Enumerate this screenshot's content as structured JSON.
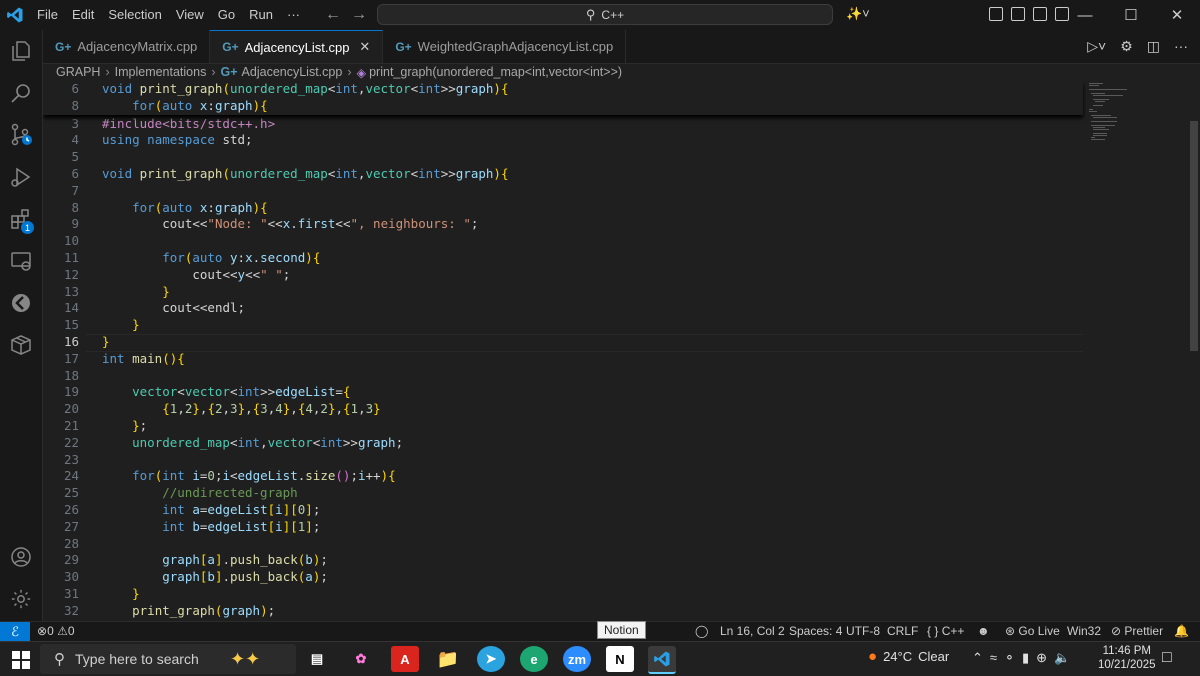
{
  "menu": [
    "File",
    "Edit",
    "Selection",
    "View",
    "Go",
    "Run",
    "···"
  ],
  "search": {
    "text": "C++"
  },
  "tabs": [
    {
      "label": "AdjacencyMatrix.cpp"
    },
    {
      "label": "AdjacencyList.cpp",
      "active": true
    },
    {
      "label": "WeightedGraphAdjacencyList.cpp"
    }
  ],
  "breadcrumb": {
    "folder": "GRAPH",
    "sub": "Implementations",
    "file": "AdjacencyList.cpp",
    "symbol": "print_graph(unordered_map<int,vector<int>>)"
  },
  "editor": {
    "sticky_lines": [
      {
        "n": "6",
        "text": "void print_graph(unordered_map<int,vector<int>>graph){"
      },
      {
        "n": "8",
        "text": "    for(auto x:graph){"
      }
    ],
    "lines": [
      {
        "n": "3",
        "text": "#include<bits/stdc++.h>"
      },
      {
        "n": "4",
        "text": "using namespace std;"
      },
      {
        "n": "5",
        "text": ""
      },
      {
        "n": "6",
        "text": "void print_graph(unordered_map<int,vector<int>>graph){"
      },
      {
        "n": "7",
        "text": ""
      },
      {
        "n": "8",
        "text": "    for(auto x:graph){"
      },
      {
        "n": "9",
        "text": "        cout<<\"Node: \"<<x.first<<\", neighbours: \";"
      },
      {
        "n": "10",
        "text": ""
      },
      {
        "n": "11",
        "text": "        for(auto y:x.second){"
      },
      {
        "n": "12",
        "text": "            cout<<y<<\" \";"
      },
      {
        "n": "13",
        "text": "        }"
      },
      {
        "n": "14",
        "text": "        cout<<endl;"
      },
      {
        "n": "15",
        "text": "    }"
      },
      {
        "n": "16",
        "text": "}"
      },
      {
        "n": "17",
        "text": "int main(){"
      },
      {
        "n": "18",
        "text": ""
      },
      {
        "n": "19",
        "text": "    vector<vector<int>>edgeList={"
      },
      {
        "n": "20",
        "text": "        {1,2},{2,3},{3,4},{4,2},{1,3}"
      },
      {
        "n": "21",
        "text": "    };"
      },
      {
        "n": "22",
        "text": "    unordered_map<int,vector<int>>graph;"
      },
      {
        "n": "23",
        "text": ""
      },
      {
        "n": "24",
        "text": "    for(int i=0;i<edgeList.size();i++){"
      },
      {
        "n": "25",
        "text": "        //undirected-graph"
      },
      {
        "n": "26",
        "text": "        int a=edgeList[i][0];"
      },
      {
        "n": "27",
        "text": "        int b=edgeList[i][1];"
      },
      {
        "n": "28",
        "text": ""
      },
      {
        "n": "29",
        "text": "        graph[a].push_back(b);"
      },
      {
        "n": "30",
        "text": "        graph[b].push_back(a);"
      },
      {
        "n": "31",
        "text": "    }"
      },
      {
        "n": "32",
        "text": "    print_graph(graph);"
      }
    ]
  },
  "statusbar": {
    "errors": "0",
    "warnings": "0",
    "tooltip": "Notion",
    "position": "Ln 16, Col 2",
    "spaces": "Spaces: 4",
    "encoding": "UTF-8",
    "eol": "CRLF",
    "language": "C++",
    "golive": "Go Live",
    "platform": "Win32",
    "prettier": "Prettier"
  },
  "taskbar": {
    "search_placeholder": "Type here to search",
    "temperature": "24°C",
    "weather": "Clear",
    "time": "11:46 PM",
    "date": "10/21/2025",
    "zoom_label": "zm"
  },
  "colors": {
    "accent": "#0078d4",
    "keyword": "#569cd6",
    "type": "#4ec9b0",
    "function": "#dcdcaa",
    "string": "#ce9178",
    "number": "#b5cea8"
  }
}
